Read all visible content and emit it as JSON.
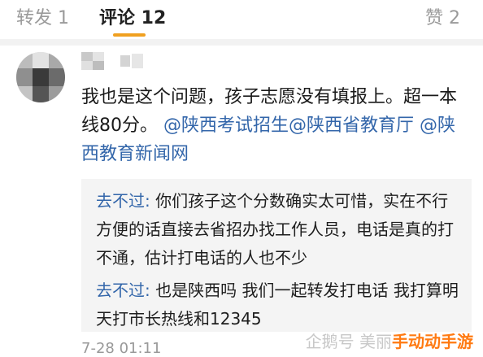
{
  "tabs": [
    {
      "label": "转发 1"
    },
    {
      "label": "评论 12"
    },
    {
      "label": "赞 2"
    }
  ],
  "comment": {
    "text": "我也是这个问题，孩子志愿没有填报上。超一本线80分。",
    "mentions": [
      "@陕西考试招生",
      "@陕西省教育厅",
      "@陕西教育新闻网"
    ],
    "replies": [
      {
        "author": "去不过:",
        "text": "你们孩子这个分数确实太可惜，实在不行方便的话直接去省招办找工作人员，电话是真的打不通，估计打电话的人也不少"
      },
      {
        "author": "去不过:",
        "text": "也是陕西吗 我们一起转发打电话 我打算明天打市长热线和12345"
      }
    ],
    "timestamp": "7-28 01:11"
  },
  "watermark": {
    "source": "企鹅号 美丽",
    "site": "手动动手游"
  },
  "colors": {
    "accent": "#f0a020",
    "mention": "#3366aa",
    "watermark": "#ff7a12"
  }
}
